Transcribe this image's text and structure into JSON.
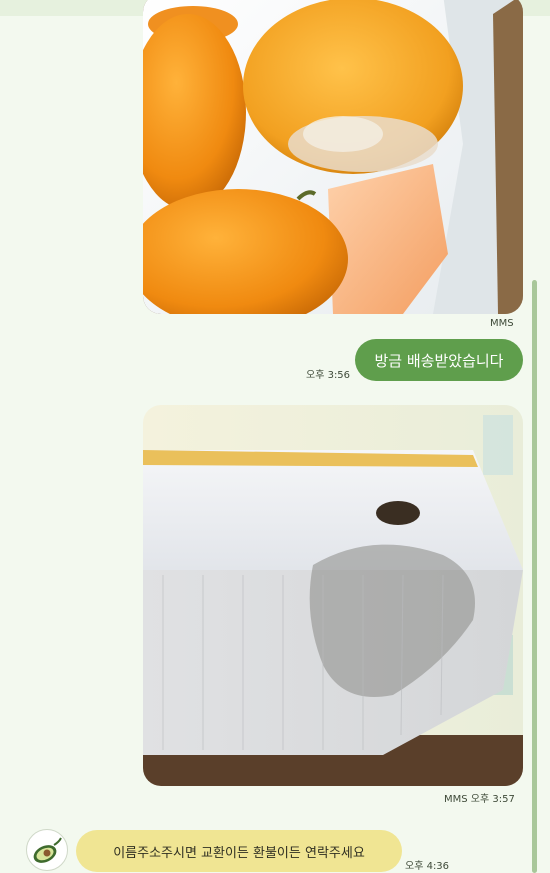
{
  "chat": {
    "messages": [
      {
        "id": "msg-1",
        "type": "image",
        "direction": "outgoing",
        "description": "photo of oranges in a box",
        "meta": "MMS"
      },
      {
        "id": "msg-2",
        "type": "text",
        "direction": "outgoing",
        "text": "방금 배송받았습니다",
        "time": "오후 3:56"
      },
      {
        "id": "msg-3",
        "type": "image",
        "direction": "outgoing",
        "description": "photo of damaged cardboard box",
        "meta": "MMS",
        "time": "오후 3:57"
      },
      {
        "id": "msg-4",
        "type": "text",
        "direction": "incoming",
        "text": "이름주소주시면 교환이든 환불이든 연락주세요",
        "time": "오후 4:36",
        "avatar_icon": "avocado-icon"
      }
    ]
  },
  "colors": {
    "background": "#f3f9ef",
    "outgoing_bubble": "#5f9e4c",
    "incoming_bubble": "#f0e593",
    "scrollbar": "#a9c79a"
  }
}
